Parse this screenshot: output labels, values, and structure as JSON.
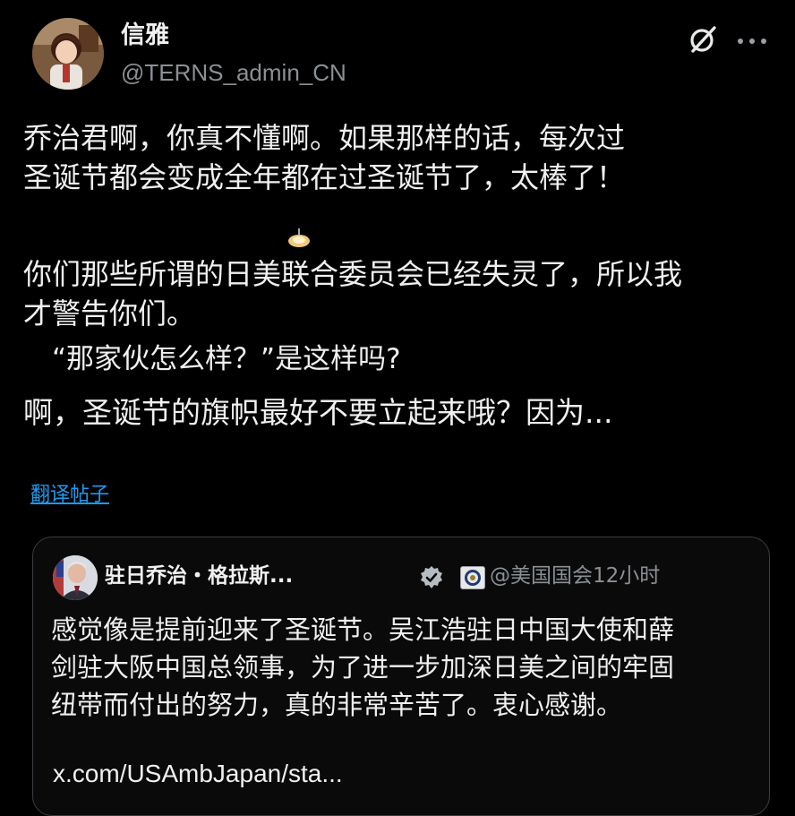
{
  "post": {
    "display_name": "信雅",
    "handle": "@TERNS_admin_CN",
    "paragraphs": {
      "p1": "乔治君啊，你真不懂啊。如果那样的话，每次过\n圣诞节都会变成全年都在过圣诞节了，太棒了！",
      "p2": "你们那些所谓的日美联合委员会已经失灵了，所以我\n才警告你们。",
      "p3": "“那家伙怎么样？”是这样吗?",
      "p4": "啊，圣诞节的旗帜最好不要立起来哦？因为..."
    },
    "translate_label": "翻译帖子"
  },
  "quote": {
    "author": "驻日乔治・格拉斯...",
    "meta": "@美国国会12小时",
    "text": "感觉像是提前迎来了圣诞节。吴江浩驻日中国大使和薛\n剑驻大阪中国总领事，为了进一步加深日美之间的牢固\n纽带而付出的努力，真的非常辛苦了。衷心感谢。",
    "link": "x.com/USAmbJapan/sta..."
  },
  "icons": {
    "top_right": "grok-slash-circle-icon",
    "more": "more-dots-icon",
    "verified": "verified-badge-icon",
    "gov": "government-seal-icon"
  },
  "colors": {
    "background": "#000000",
    "text": "#f0f0f0",
    "secondary": "#8b9095",
    "link": "#1d9bf0"
  }
}
